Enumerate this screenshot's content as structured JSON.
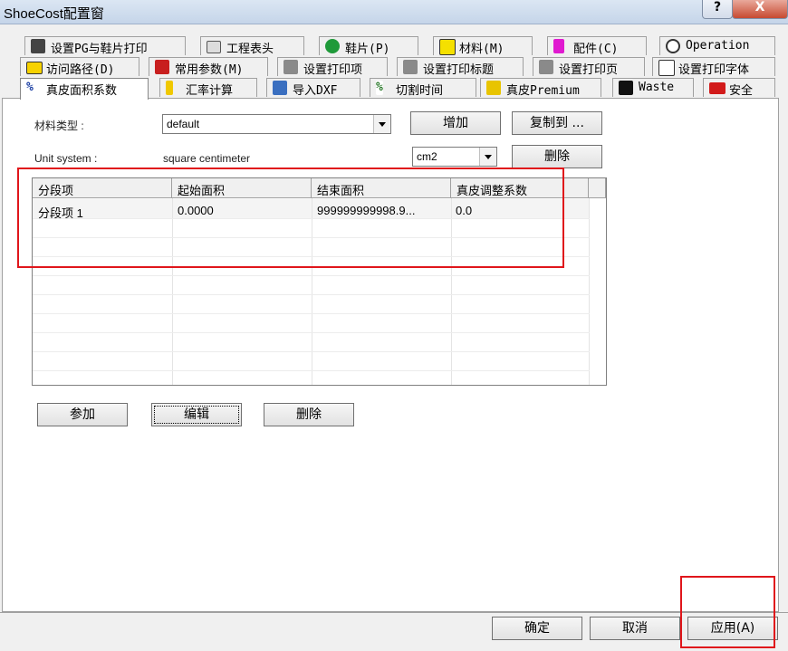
{
  "window": {
    "title": "ShoeCost配置窗",
    "help_label": "?",
    "close_label": "X"
  },
  "tabs_row1": [
    {
      "label": "设置PG与鞋片打印",
      "icon": "print-pg-icon"
    },
    {
      "label": "工程表头",
      "icon": "table-header-icon"
    },
    {
      "label": "鞋片(P)",
      "icon": "refresh-piece-icon"
    },
    {
      "label": "材料(M)",
      "icon": "material-icon"
    },
    {
      "label": "配件(C)",
      "icon": "accessory-icon"
    },
    {
      "label": "Operation",
      "icon": "clock-icon"
    }
  ],
  "tabs_row2": [
    {
      "label": "访问路径(D)",
      "icon": "folder-icon"
    },
    {
      "label": "常用参数(M)",
      "icon": "parameters-icon"
    },
    {
      "label": "设置打印项",
      "icon": "printer-icon"
    },
    {
      "label": "设置打印标题",
      "icon": "printer-icon"
    },
    {
      "label": "设置打印页",
      "icon": "printer-icon"
    },
    {
      "label": "设置打印字体",
      "icon": "font-ab-icon"
    }
  ],
  "tabs_row3": [
    {
      "label": "真皮面积系数",
      "icon": "percent-icon",
      "active": true
    },
    {
      "label": "汇率计算",
      "icon": "currency-icon"
    },
    {
      "label": "导入DXF",
      "icon": "dxf-icon"
    },
    {
      "label": "切割时间",
      "icon": "cut-percent-icon"
    },
    {
      "label": "真皮Premium",
      "icon": "leather-icon"
    },
    {
      "label": "Waste",
      "icon": "waste-w-icon"
    },
    {
      "label": "安全",
      "icon": "security-cs-icon"
    }
  ],
  "form": {
    "material_type_label": "材料类型 :",
    "material_type_value": "default",
    "unit_system_label": "Unit system :",
    "unit_system_text": "square centimeter",
    "unit_value": "cm2",
    "add_button": "增加",
    "copy_to_button": "复制到 ...",
    "delete_top_button": "删除"
  },
  "grid": {
    "columns": [
      "分段项",
      "起始面积",
      "结束面积",
      "真皮调整系数"
    ],
    "rows": [
      [
        "分段项 1",
        "0.0000",
        "999999999998.9...",
        "0.0"
      ]
    ]
  },
  "row_buttons": {
    "add": "参加",
    "edit": "编辑",
    "delete": "删除"
  },
  "footer": {
    "ok": "确定",
    "cancel": "取消",
    "apply": "应用(A)"
  },
  "colors": {
    "highlight_box": "#e0161b"
  }
}
